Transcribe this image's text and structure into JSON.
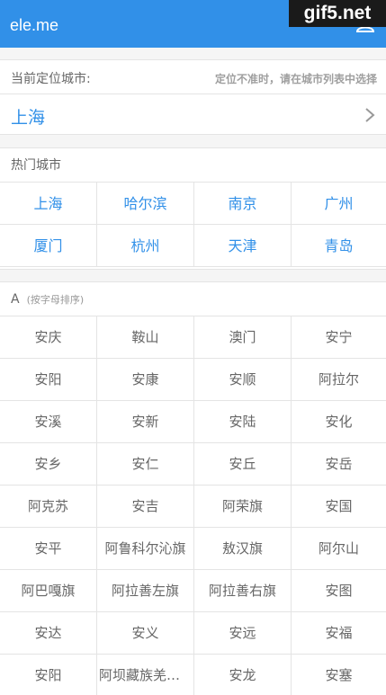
{
  "header": {
    "title": "ele.me"
  },
  "watermark": "gif5.net",
  "location": {
    "label": "当前定位城市:",
    "tip": "定位不准时，请在城市列表中选择",
    "city": "上海"
  },
  "hot": {
    "title": "热门城市",
    "cities": [
      "上海",
      "哈尔滨",
      "南京",
      "广州",
      "厦门",
      "杭州",
      "天津",
      "青岛"
    ]
  },
  "group_a": {
    "letter": "A",
    "sub": "(按字母排序)",
    "cities": [
      "安庆",
      "鞍山",
      "澳门",
      "安宁",
      "安阳",
      "安康",
      "安顺",
      "阿拉尔",
      "安溪",
      "安新",
      "安陆",
      "安化",
      "安乡",
      "安仁",
      "安丘",
      "安岳",
      "阿克苏",
      "安吉",
      "阿荣旗",
      "安国",
      "安平",
      "阿鲁科尔沁旗",
      "敖汉旗",
      "阿尔山",
      "阿巴嘎旗",
      "阿拉善左旗",
      "阿拉善右旗",
      "安图",
      "安达",
      "安义",
      "安远",
      "安福",
      "安阳",
      "阿坝藏族羌族自治州",
      "安龙",
      "安塞"
    ]
  }
}
